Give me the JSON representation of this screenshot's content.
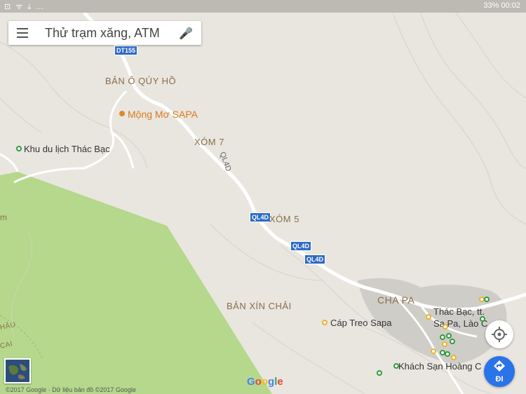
{
  "status_bar": {
    "left_icons": "⊡ ᯤ ⤓ …",
    "battery": "33%",
    "time": "00:02"
  },
  "search": {
    "placeholder": "Thử trạm xăng, ATM",
    "menu_icon": "menu-icon",
    "mic_icon": "mic-icon"
  },
  "labels": {
    "ban_o_quy_ho": "BẢN Ô QÚY HỒ",
    "mong_mo": "Mộng Mơ SAPA",
    "khu_du_lich": "Khu du lịch Thác Bạc",
    "xom7": "XÓM 7",
    "xom5": "XÓM 5",
    "ql4d_rotated": "QL4D",
    "cha_pa": "CHA PA",
    "ban_xin_chai": "BẢN XÍN CHẢI",
    "cap_treo": "Cáp Treo Sapa",
    "thac_bac_1": "Thác Bạc, tt.",
    "thac_bac_2": "Sa Pa, Lào C",
    "khach_san": "Khách Sạn Hoàng C",
    "left_edge_m": "m",
    "left_edge_hau": "HÂU",
    "left_edge_cai": "CAI"
  },
  "shields": {
    "dt155": "DT155",
    "ql4d_a": "QL4D",
    "ql4d_b": "QL4D",
    "ql4d_c": "QL4D"
  },
  "buttons": {
    "go_label": "ĐI"
  },
  "footer": {
    "copyright": "©2017 Google · Dữ liệu bản đồ ©2017 Google",
    "google_logo": "Google"
  },
  "colors": {
    "land": "#e9e6e0",
    "park": "#b5d88c",
    "road": "#ffffff",
    "shield": "#2d6ac5",
    "go_button": "#2a73e8"
  }
}
